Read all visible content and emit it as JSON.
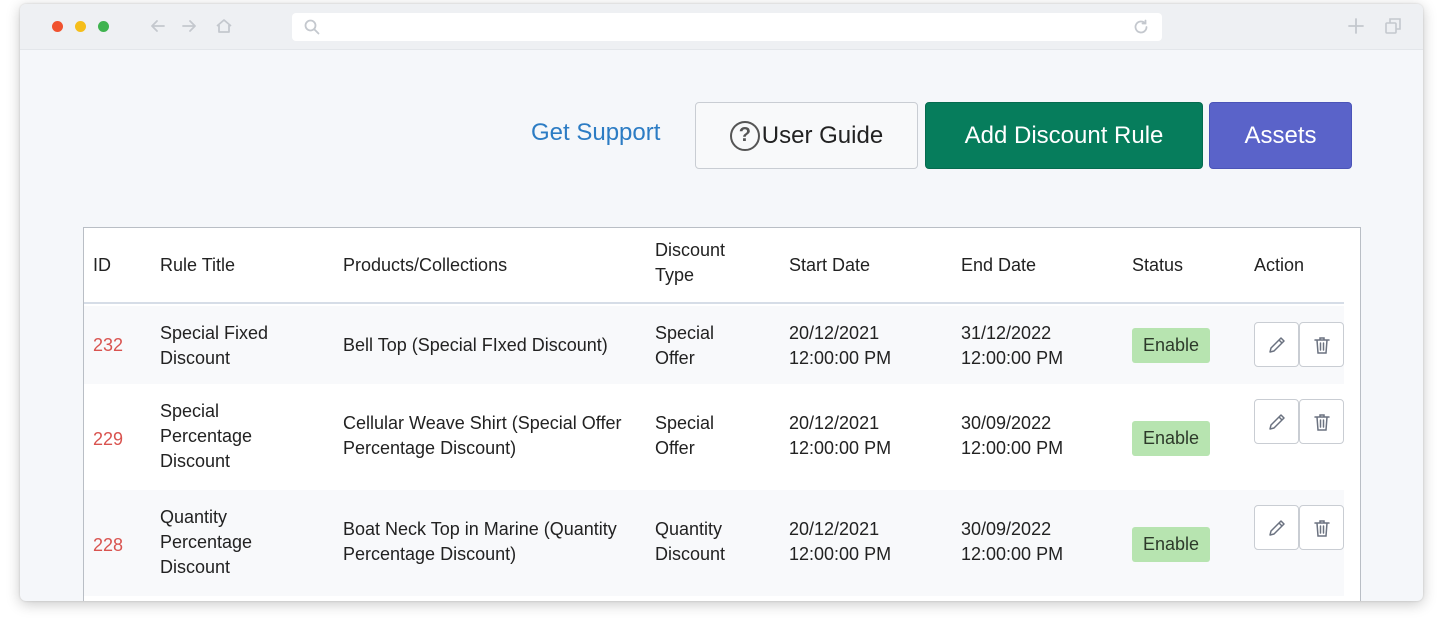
{
  "browser": {
    "url": "",
    "icons": [
      "back-arrow-icon",
      "forward-arrow-icon",
      "home-icon",
      "search-icon",
      "reload-icon",
      "new-tab-icon",
      "tabs-icon"
    ]
  },
  "toolbar": {
    "get_support": "Get Support",
    "user_guide": "User Guide",
    "user_guide_icon": "?",
    "add_rule": "Add Discount Rule",
    "assets": "Assets"
  },
  "table": {
    "headers": {
      "id": "ID",
      "title": "Rule Title",
      "products": "Products/Collections",
      "type_line1": "Discount",
      "type_line2": "Type",
      "start": "Start Date",
      "end": "End Date",
      "status": "Status",
      "action": "Action"
    },
    "rows": [
      {
        "id": "232",
        "title": [
          "Special Fixed",
          "Discount"
        ],
        "products": [
          "Bell Top (Special FIxed Discount)"
        ],
        "type": [
          "Special",
          "Offer"
        ],
        "start": [
          "20/12/2021",
          "12:00:00 PM"
        ],
        "end": [
          "31/12/2022",
          "12:00:00 PM"
        ],
        "status": "Enable"
      },
      {
        "id": "229",
        "title": [
          "Special",
          "Percentage",
          "Discount"
        ],
        "products": [
          "Cellular Weave Shirt (Special Offer",
          "Percentage Discount)"
        ],
        "type": [
          "Special",
          "Offer"
        ],
        "start": [
          "20/12/2021",
          "12:00:00 PM"
        ],
        "end": [
          "30/09/2022",
          "12:00:00 PM"
        ],
        "status": "Enable"
      },
      {
        "id": "228",
        "title": [
          "Quantity",
          "Percentage",
          "Discount"
        ],
        "products": [
          "Boat Neck Top in Marine (Quantity",
          "Percentage Discount)"
        ],
        "type": [
          "Quantity",
          "Discount"
        ],
        "start": [
          "20/12/2021",
          "12:00:00 PM"
        ],
        "end": [
          "30/09/2022",
          "12:00:00 PM"
        ],
        "status": "Enable"
      }
    ]
  },
  "colors": {
    "link": "#2c7cc4",
    "add_button": "#067d5c",
    "assets_button": "#5a63c9",
    "id_text": "#d9534f",
    "status_enable": "#b7e4b0"
  }
}
